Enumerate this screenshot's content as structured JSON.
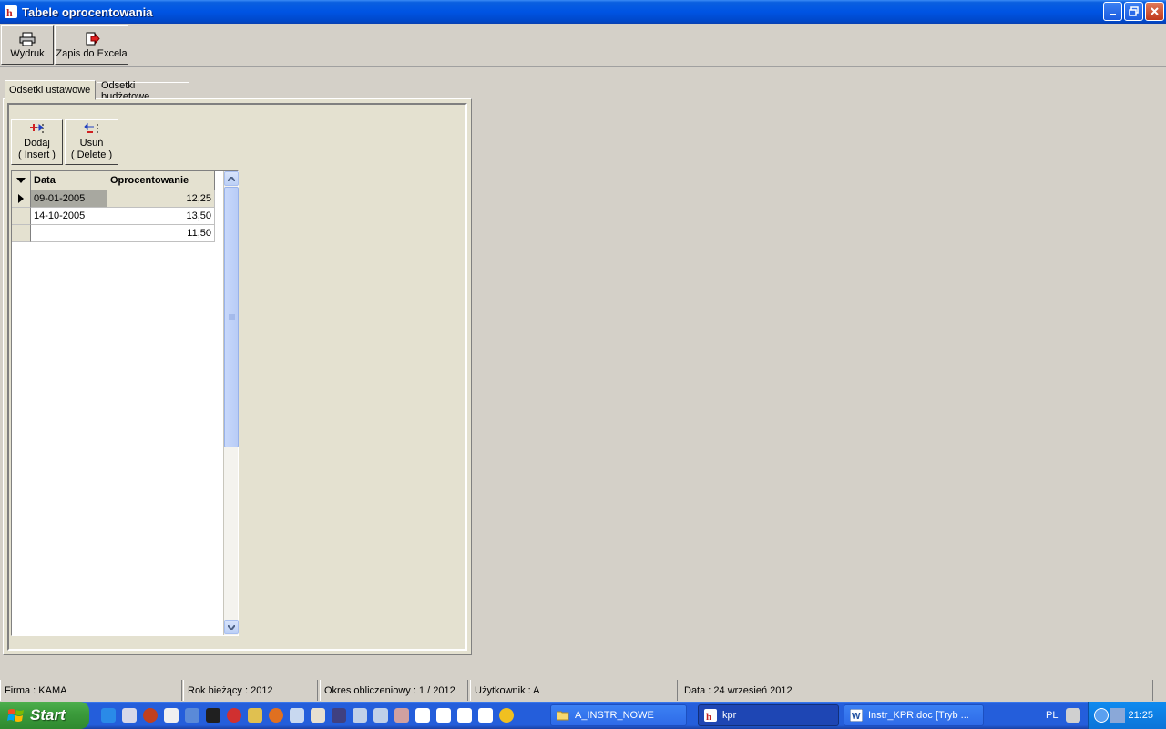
{
  "window": {
    "title": "Tabele oprocentowania"
  },
  "toolbar": {
    "print_label": "Wydruk",
    "excel_label": "Zapis do Excela"
  },
  "tabs": [
    {
      "label": "Odsetki ustawowe",
      "active": true
    },
    {
      "label": "Odsetki budżetowe",
      "active": false
    }
  ],
  "actions": {
    "add_label": "Dodaj",
    "add_key": "( Insert )",
    "delete_label": "Usuń",
    "delete_key": "( Delete )"
  },
  "grid": {
    "columns": [
      "Data",
      "Oprocentowanie"
    ],
    "rows": [
      {
        "date": "09-01-2005",
        "rate": "12,25",
        "selected": true
      },
      {
        "date": "14-10-2005",
        "rate": "13,50",
        "selected": false
      },
      {
        "date": "",
        "rate": "11,50",
        "selected": false
      }
    ]
  },
  "status": {
    "firm": "Firma : KAMA",
    "year": "Rok bieżący : 2012",
    "period": "Okres obliczeniowy : 1 / 2012",
    "user": "Użytkownik : A",
    "date": "Data : 24 wrzesień 2012"
  },
  "taskbar": {
    "start_label": "Start",
    "tasks": [
      "A_INSTR_NOWE",
      "kpr",
      "Instr_KPR.doc [Tryb ..."
    ],
    "language": "PL",
    "clock": "21:25"
  },
  "colors": {
    "titlebar": "#0054e3",
    "panel": "#e4e1d0",
    "taskbar": "#245edb",
    "start": "#3c9c3c"
  }
}
